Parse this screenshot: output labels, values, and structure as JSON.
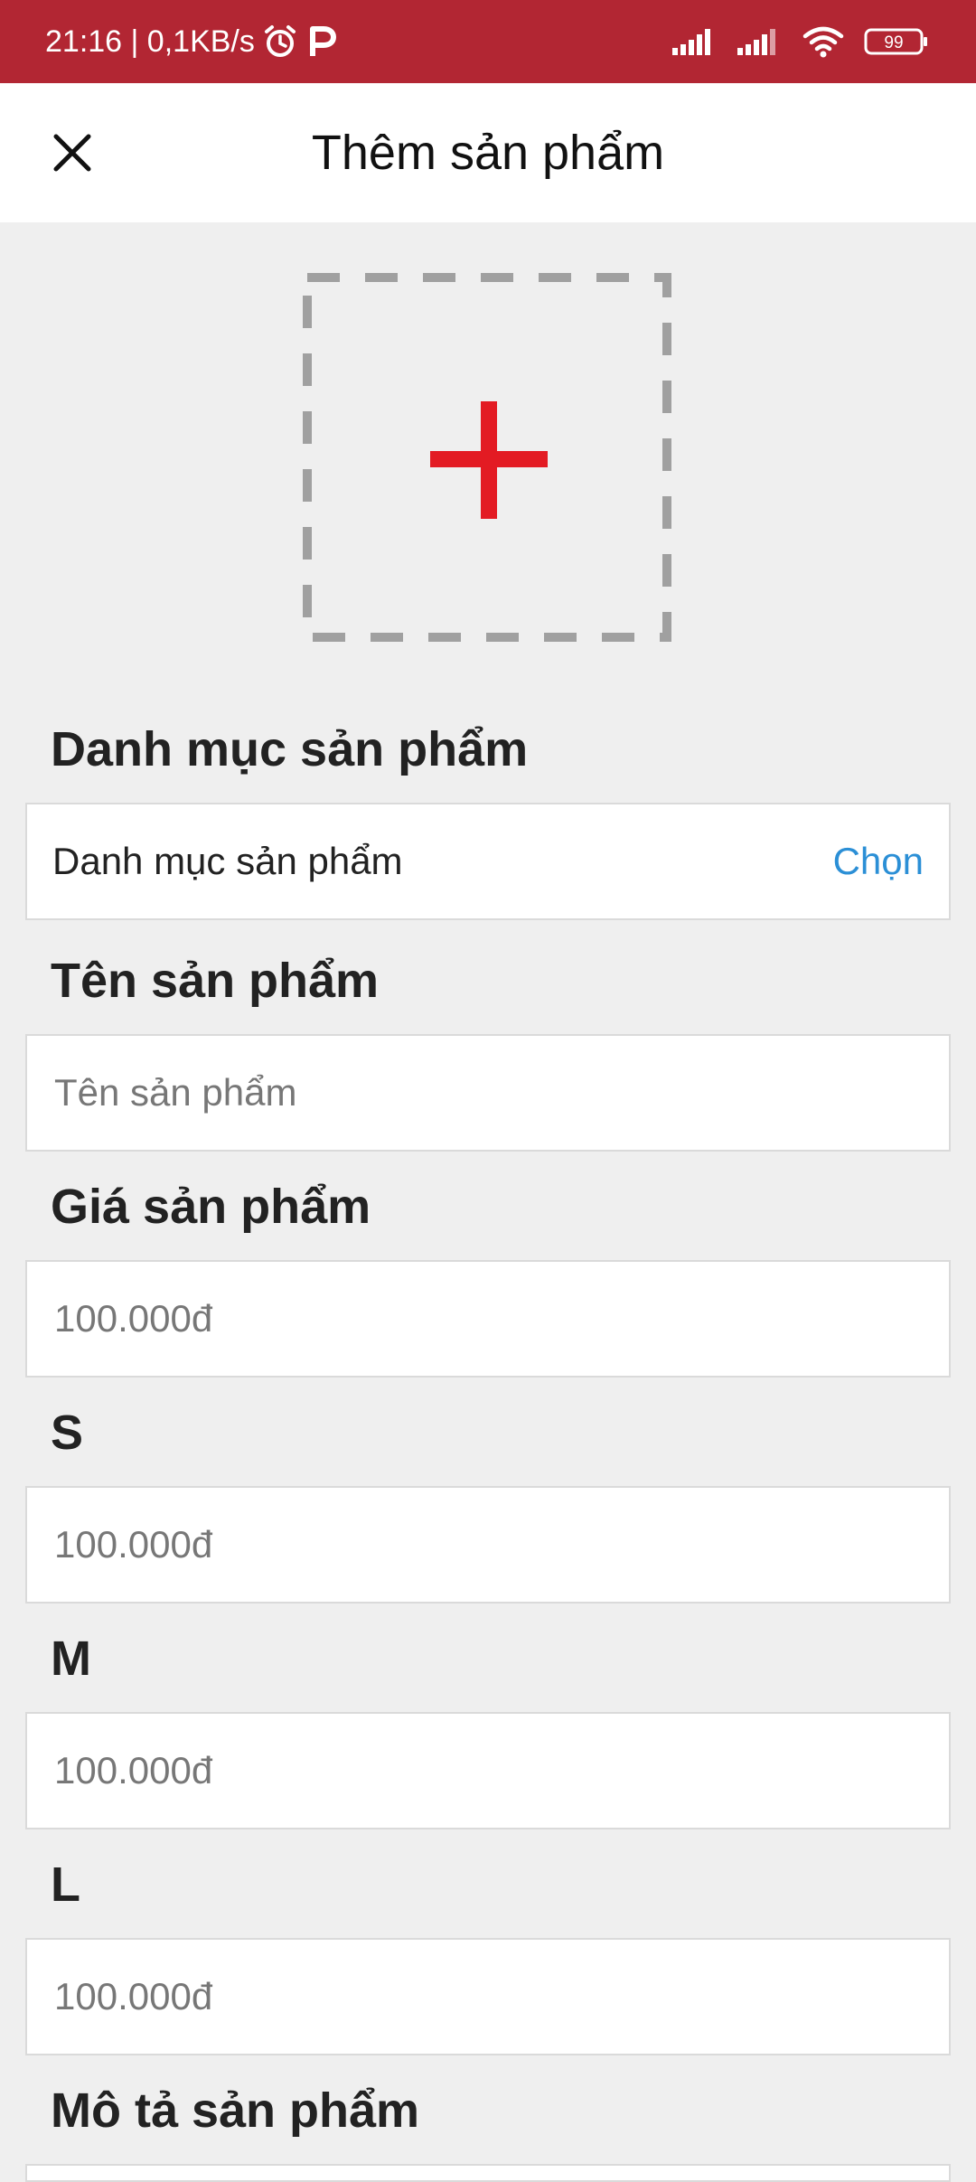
{
  "status_bar": {
    "time_network": "21:16 | 0,1KB/s",
    "battery": "99",
    "icons": [
      "alarm-icon",
      "p-app-icon",
      "signal-icon",
      "signal-icon",
      "wifi-icon",
      "battery-icon"
    ]
  },
  "header": {
    "title": "Thêm sản phẩm",
    "close_icon": "close-icon"
  },
  "image_upload": {
    "icon": "plus-icon",
    "accent_color": "#e31b23"
  },
  "form": {
    "category": {
      "label": "Danh mục sản phẩm",
      "value": "Danh mục sản phẩm",
      "action": "Chọn"
    },
    "name": {
      "label": "Tên sản phẩm",
      "placeholder": "Tên sản phẩm"
    },
    "price": {
      "label": "Giá sản phẩm",
      "placeholder": "100.000đ"
    },
    "size_s": {
      "label": "S",
      "placeholder": "100.000đ"
    },
    "size_m": {
      "label": "M",
      "placeholder": "100.000đ"
    },
    "size_l": {
      "label": "L",
      "placeholder": "100.000đ"
    },
    "description": {
      "label": "Mô tả sản phẩm"
    }
  },
  "colors": {
    "status_bar": "#b22633",
    "link": "#2b8fd6",
    "background": "#efefef"
  }
}
